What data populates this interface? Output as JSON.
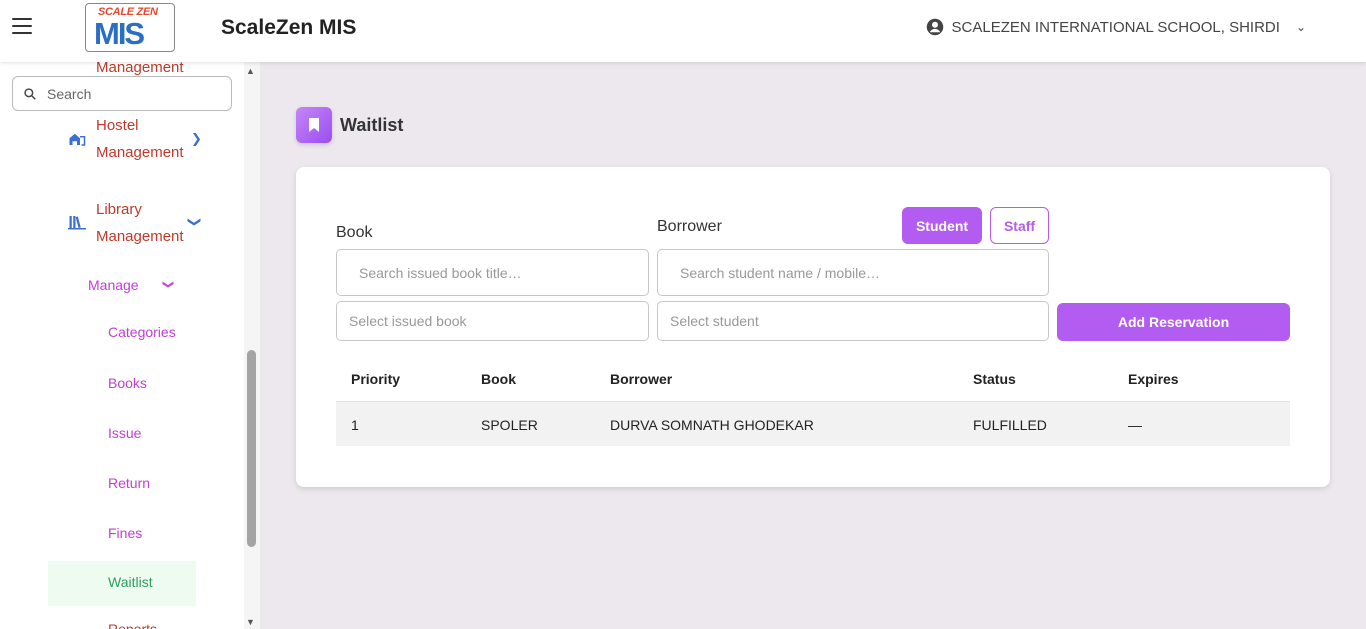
{
  "header": {
    "logo_top": "SCALE ZEN",
    "logo_main": "MIS",
    "app_title": "ScaleZen MIS",
    "school_name": "SCALEZEN INTERNATIONAL SCHOOL, SHIRDI",
    "icons": {
      "menu": "hamburger-icon",
      "account": "account-circle-icon",
      "dropdown": "chevron-down-icon"
    }
  },
  "sidebar": {
    "search_placeholder": "Search",
    "partial_top": "Management",
    "hostel": {
      "line1": "Hostel",
      "line2": "Management"
    },
    "library": {
      "line1": "Library",
      "line2": "Management"
    },
    "manage_label": "Manage",
    "links": [
      "Categories",
      "Books",
      "Issue",
      "Return",
      "Fines"
    ],
    "active_link": "Waitlist",
    "partial_bottom": "Reports"
  },
  "page": {
    "title": "Waitlist",
    "icon": "bookmark-icon"
  },
  "form": {
    "book_label": "Book",
    "borrower_label": "Borrower",
    "toggle_student": "Student",
    "toggle_staff": "Staff",
    "book_search_placeholder": "Search issued book title…",
    "borrower_search_placeholder": "Search student name / mobile…",
    "book_select_placeholder": "Select issued book",
    "borrower_select_placeholder": "Select student",
    "add_button": "Add Reservation"
  },
  "table": {
    "columns": [
      "Priority",
      "Book",
      "Borrower",
      "Status",
      "Expires"
    ],
    "rows": [
      [
        "1",
        "SPOLER",
        "DURVA SOMNATH GHODEKAR",
        "FULFILLED",
        "—"
      ]
    ]
  },
  "colors": {
    "accent": "#b35cf2",
    "sidebar_text": "#c0392b",
    "link": "#c03fd6",
    "active": "#2f9e5f"
  }
}
